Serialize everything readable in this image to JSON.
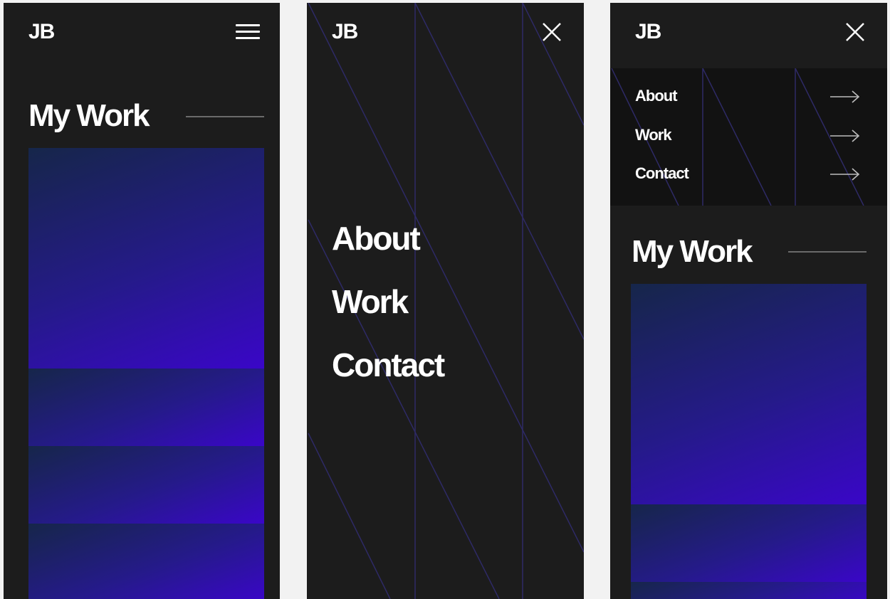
{
  "panels": {
    "home": {
      "logo": "JB",
      "section_title": "My Work"
    },
    "menu_full": {
      "logo": "JB",
      "nav": [
        "About",
        "Work",
        "Contact"
      ]
    },
    "menu_dropdown": {
      "logo": "JB",
      "nav": [
        "About",
        "Work",
        "Contact"
      ],
      "section_title": "My Work"
    }
  },
  "icons": {
    "menu": "hamburger-icon",
    "close": "close-icon",
    "nav_arrow": "arrow-right-icon"
  },
  "colors": {
    "page_background": "#f2f2f2",
    "panel_background": "#1c1c1c",
    "dropdown_background": "#121212",
    "accent_start": "#16264a",
    "accent_end": "#3a06c8",
    "decor_lines": "#2e2a66"
  }
}
